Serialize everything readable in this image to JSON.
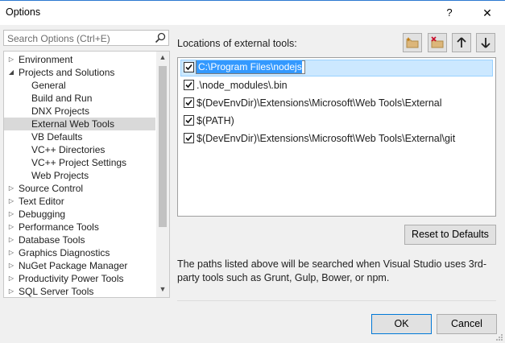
{
  "window": {
    "title": "Options",
    "help_label": "?",
    "close_label": "✕"
  },
  "search": {
    "placeholder": "Search Options (Ctrl+E)"
  },
  "tree": {
    "items": [
      {
        "label": "Environment",
        "expander": "collapsed"
      },
      {
        "label": "Projects and Solutions",
        "expander": "expanded"
      },
      {
        "label": "General",
        "expander": "none"
      },
      {
        "label": "Build and Run",
        "expander": "none"
      },
      {
        "label": "DNX Projects",
        "expander": "none"
      },
      {
        "label": "External Web Tools",
        "expander": "none",
        "selected": true
      },
      {
        "label": "VB Defaults",
        "expander": "none"
      },
      {
        "label": "VC++ Directories",
        "expander": "none"
      },
      {
        "label": "VC++ Project Settings",
        "expander": "none"
      },
      {
        "label": "Web Projects",
        "expander": "none"
      },
      {
        "label": "Source Control",
        "expander": "collapsed"
      },
      {
        "label": "Text Editor",
        "expander": "collapsed"
      },
      {
        "label": "Debugging",
        "expander": "collapsed"
      },
      {
        "label": "Performance Tools",
        "expander": "collapsed"
      },
      {
        "label": "Database Tools",
        "expander": "collapsed"
      },
      {
        "label": "Graphics Diagnostics",
        "expander": "collapsed"
      },
      {
        "label": "NuGet Package Manager",
        "expander": "collapsed"
      },
      {
        "label": "Productivity Power Tools",
        "expander": "collapsed"
      },
      {
        "label": "SQL Server Tools",
        "expander": "collapsed"
      }
    ]
  },
  "locations": {
    "label": "Locations of external tools:",
    "toolbar_icons": [
      "new-folder-icon",
      "delete-folder-icon",
      "move-up-icon",
      "move-down-icon"
    ],
    "rows": [
      {
        "path": "C:\\Program Files\\nodejs",
        "checked": true,
        "editing": true
      },
      {
        "path": ".\\node_modules\\.bin",
        "checked": true
      },
      {
        "path": "$(DevEnvDir)\\Extensions\\Microsoft\\Web Tools\\External",
        "checked": true
      },
      {
        "path": "$(PATH)",
        "checked": true
      },
      {
        "path": "$(DevEnvDir)\\Extensions\\Microsoft\\Web Tools\\External\\git",
        "checked": true
      }
    ]
  },
  "reset_label": "Reset to Defaults",
  "description": "The paths listed above will be searched when Visual Studio uses 3rd-party tools such as Grunt, Gulp, Bower, or npm.",
  "footer": {
    "ok_label": "OK",
    "cancel_label": "Cancel"
  },
  "colors": {
    "accent": "#0078d7",
    "selection_bg": "#cce8ff",
    "tree_selection_bg": "#d9d9d9"
  }
}
